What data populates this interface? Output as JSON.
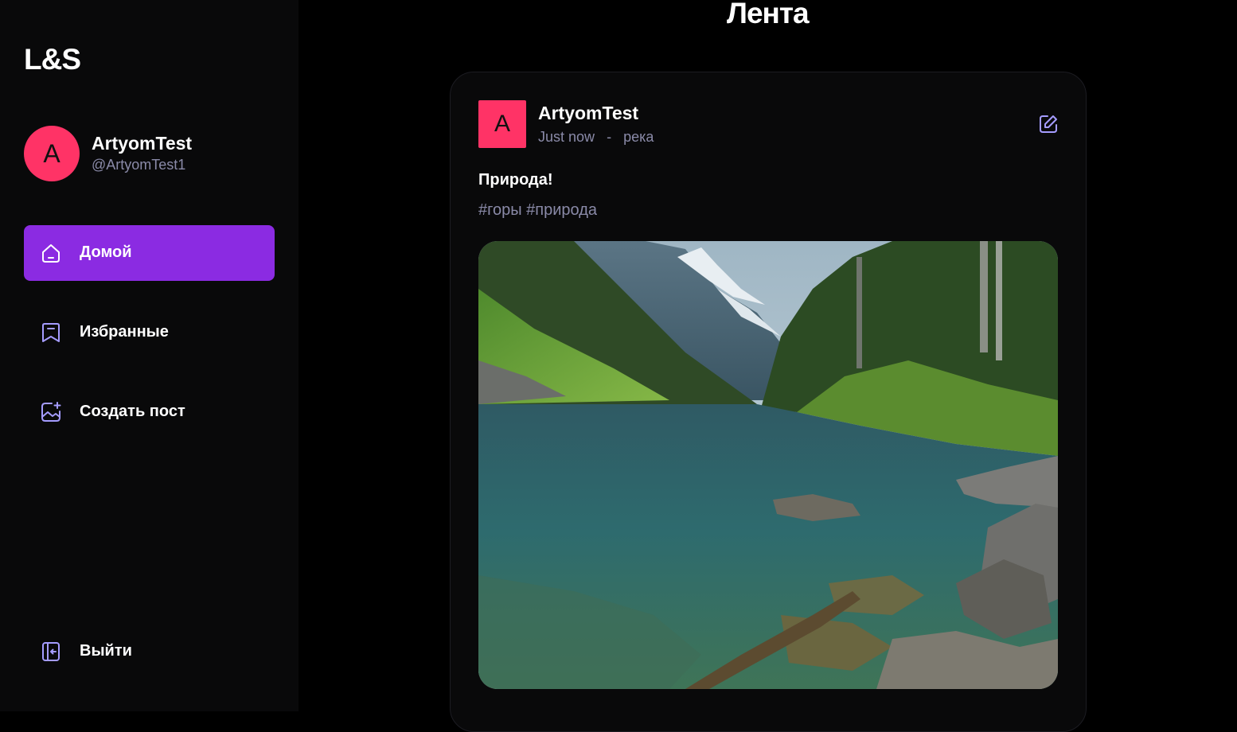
{
  "app": {
    "logo": "L&S"
  },
  "profile": {
    "avatar_letter": "A",
    "name": "ArtyomTest",
    "handle": "@ArtyomTest1",
    "avatar_color": "#ff3366"
  },
  "sidebar": {
    "items": [
      {
        "label": "Домой",
        "icon": "home-icon",
        "active": true
      },
      {
        "label": "Избранные",
        "icon": "bookmark-icon",
        "active": false
      },
      {
        "label": "Создать пост",
        "icon": "image-add-icon",
        "active": false
      }
    ],
    "logout_label": "Выйти",
    "logout_icon": "logout-icon"
  },
  "main": {
    "title": "Лента"
  },
  "post": {
    "avatar_letter": "A",
    "author": "ArtyomTest",
    "time": "Just now",
    "separator": "-",
    "location": "река",
    "text": "Природа!",
    "tags": "#горы #природа",
    "image_subject": "mountain-lake-landscape",
    "edit_icon": "edit-icon"
  },
  "colors": {
    "accent": "#8b2be2",
    "avatar": "#ff3366",
    "muted_text": "#8a8aa8",
    "icon_stroke": "#a59cff",
    "sidebar_bg": "#09090a",
    "page_bg": "#000000"
  }
}
